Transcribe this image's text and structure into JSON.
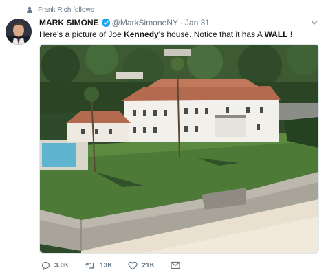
{
  "context": {
    "text": "Frank Rich follows"
  },
  "tweet": {
    "author_name": "MARK SIMONE",
    "handle": "@MarkSimoneNY",
    "separator": "·",
    "time": "Jan 31",
    "text_parts": {
      "p1": "Here's a picture of Joe ",
      "p2": "Kennedy",
      "p3": "'s house. Notice that it has A ",
      "p4": "WALL",
      "p5": " !"
    }
  },
  "actions": {
    "reply_count": "3.0K",
    "retweet_count": "13K",
    "like_count": "21K"
  },
  "icons": [
    "person-icon",
    "verified-icon",
    "caret-down-icon",
    "reply-icon",
    "retweet-icon",
    "like-icon",
    "message-icon"
  ],
  "colors": {
    "verified": "#1da1f2",
    "muted": "#657786",
    "text": "#14171a"
  }
}
